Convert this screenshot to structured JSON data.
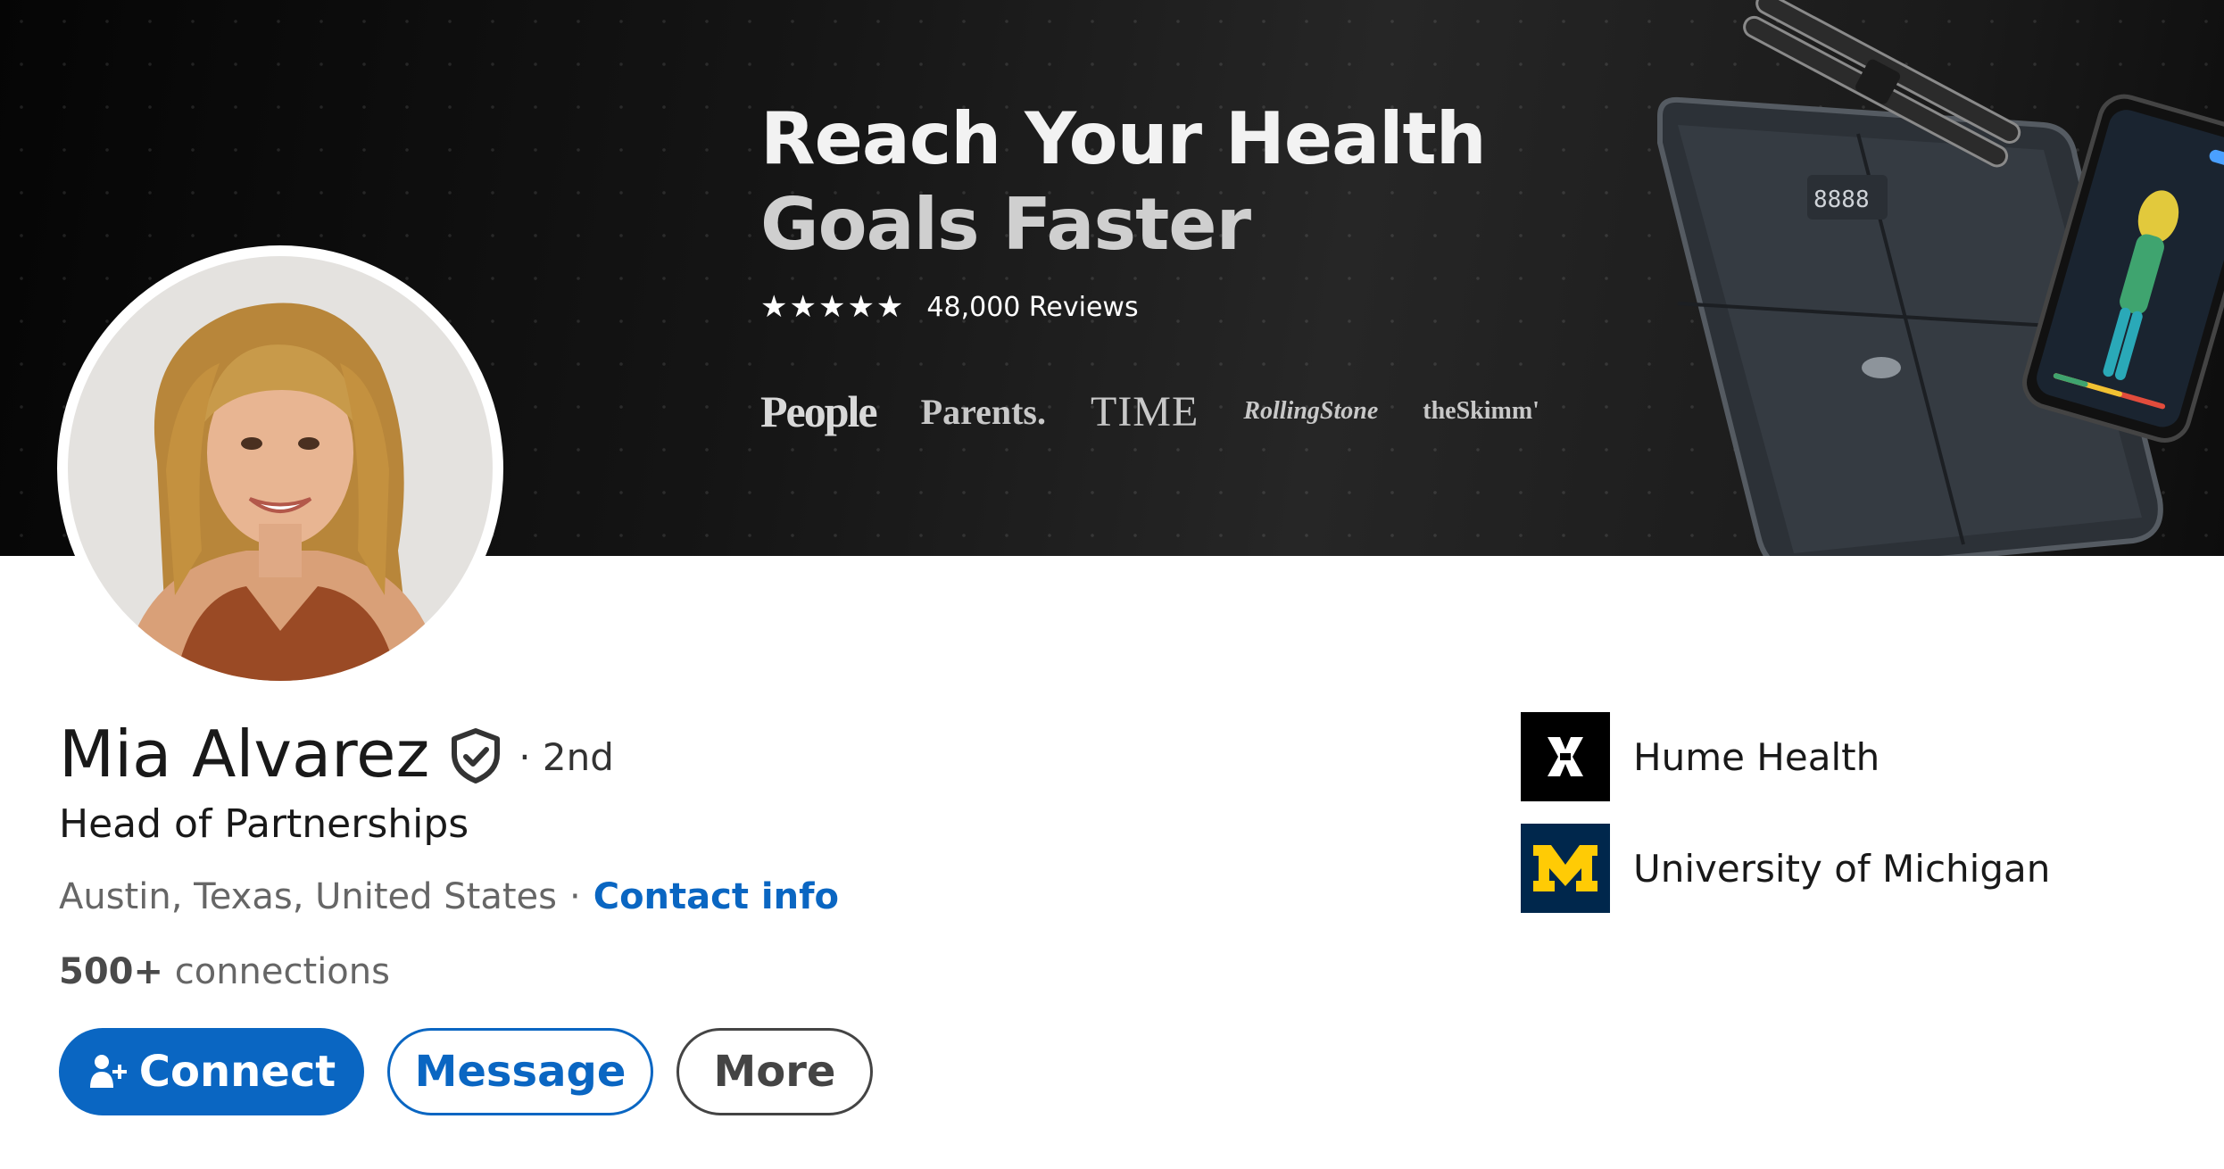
{
  "banner": {
    "headline_line1": "Reach Your Health",
    "headline_line2": "Goals Faster",
    "stars": "★★★★★",
    "reviews": "48,000 Reviews",
    "press": [
      "People",
      "Parents.",
      "TIME",
      "RollingStone",
      "theSkimm'"
    ]
  },
  "profile": {
    "name": "Mia Alvarez",
    "degree": "· 2nd",
    "headline": "Head of Partnerships",
    "location": "Austin, Texas, United States",
    "separator": "·",
    "contact_info": "Contact info",
    "connections_count": "500+",
    "connections_label": "connections"
  },
  "actions": {
    "connect": "Connect",
    "message": "Message",
    "more": "More"
  },
  "organizations": [
    {
      "name": "Hume Health",
      "logo": "hume-health-logo"
    },
    {
      "name": "University of Michigan",
      "logo": "block-m-logo"
    }
  ],
  "colors": {
    "primary": "#0a66c2",
    "um_blue": "#00274c",
    "um_maize": "#ffcb05"
  },
  "icons": [
    "verified-shield-icon",
    "add-person-icon"
  ]
}
